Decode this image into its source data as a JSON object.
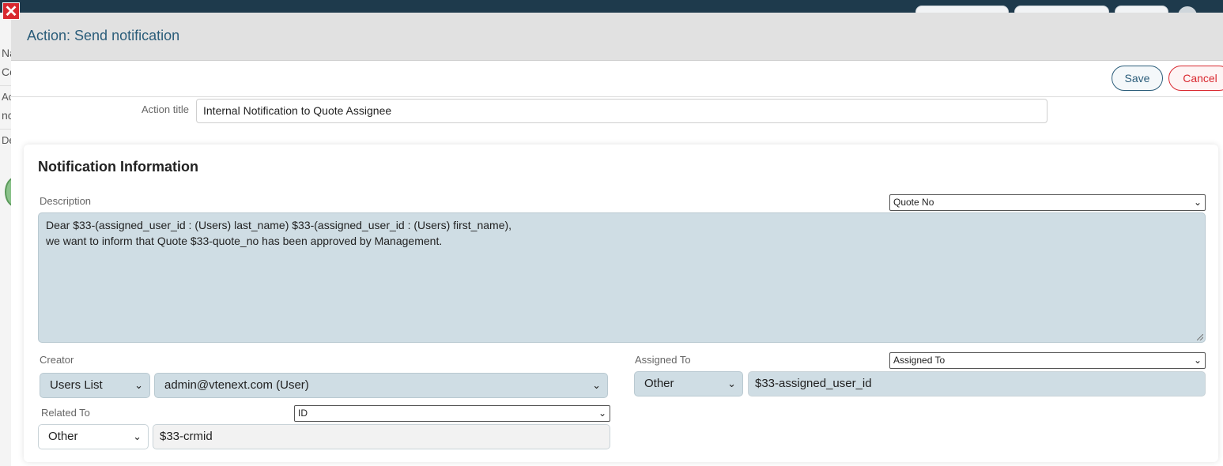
{
  "modal": {
    "title": "Action: Send notification",
    "save_label": "Save",
    "cancel_label": "Cancel",
    "close_glyph": "✕",
    "action_title_label": "Action title",
    "action_title_value": "Internal Notification to Quote Assignee"
  },
  "card": {
    "title": "Notification Information",
    "description_label": "Description",
    "description_field_select": "Quote No",
    "description_line1": "Dear $33-(assigned_user_id : (Users) last_name) $33-(assigned_user_id : (Users) first_name),",
    "description_line2": "we want to inform that Quote $33-quote_no has been approved by Management.",
    "creator_label": "Creator",
    "creator_type": "Users List",
    "creator_value": "admin@vtenext.com (User)",
    "assigned_label": "Assigned To",
    "assigned_field_select": "Assigned To",
    "assigned_type": "Other",
    "assigned_value": "$33-assigned_user_id",
    "related_label": "Related To",
    "related_field_select": "ID",
    "related_type": "Other",
    "related_value": "$33-crmid"
  },
  "background": {
    "left_snippets": [
      "Na",
      "Co",
      "Ac",
      "nc",
      "De"
    ]
  },
  "icons": {
    "dropdown": "⌄"
  },
  "colors": {
    "accent": "#2b5d7a",
    "danger": "#d9282f",
    "field_bg": "#cfdde4"
  }
}
